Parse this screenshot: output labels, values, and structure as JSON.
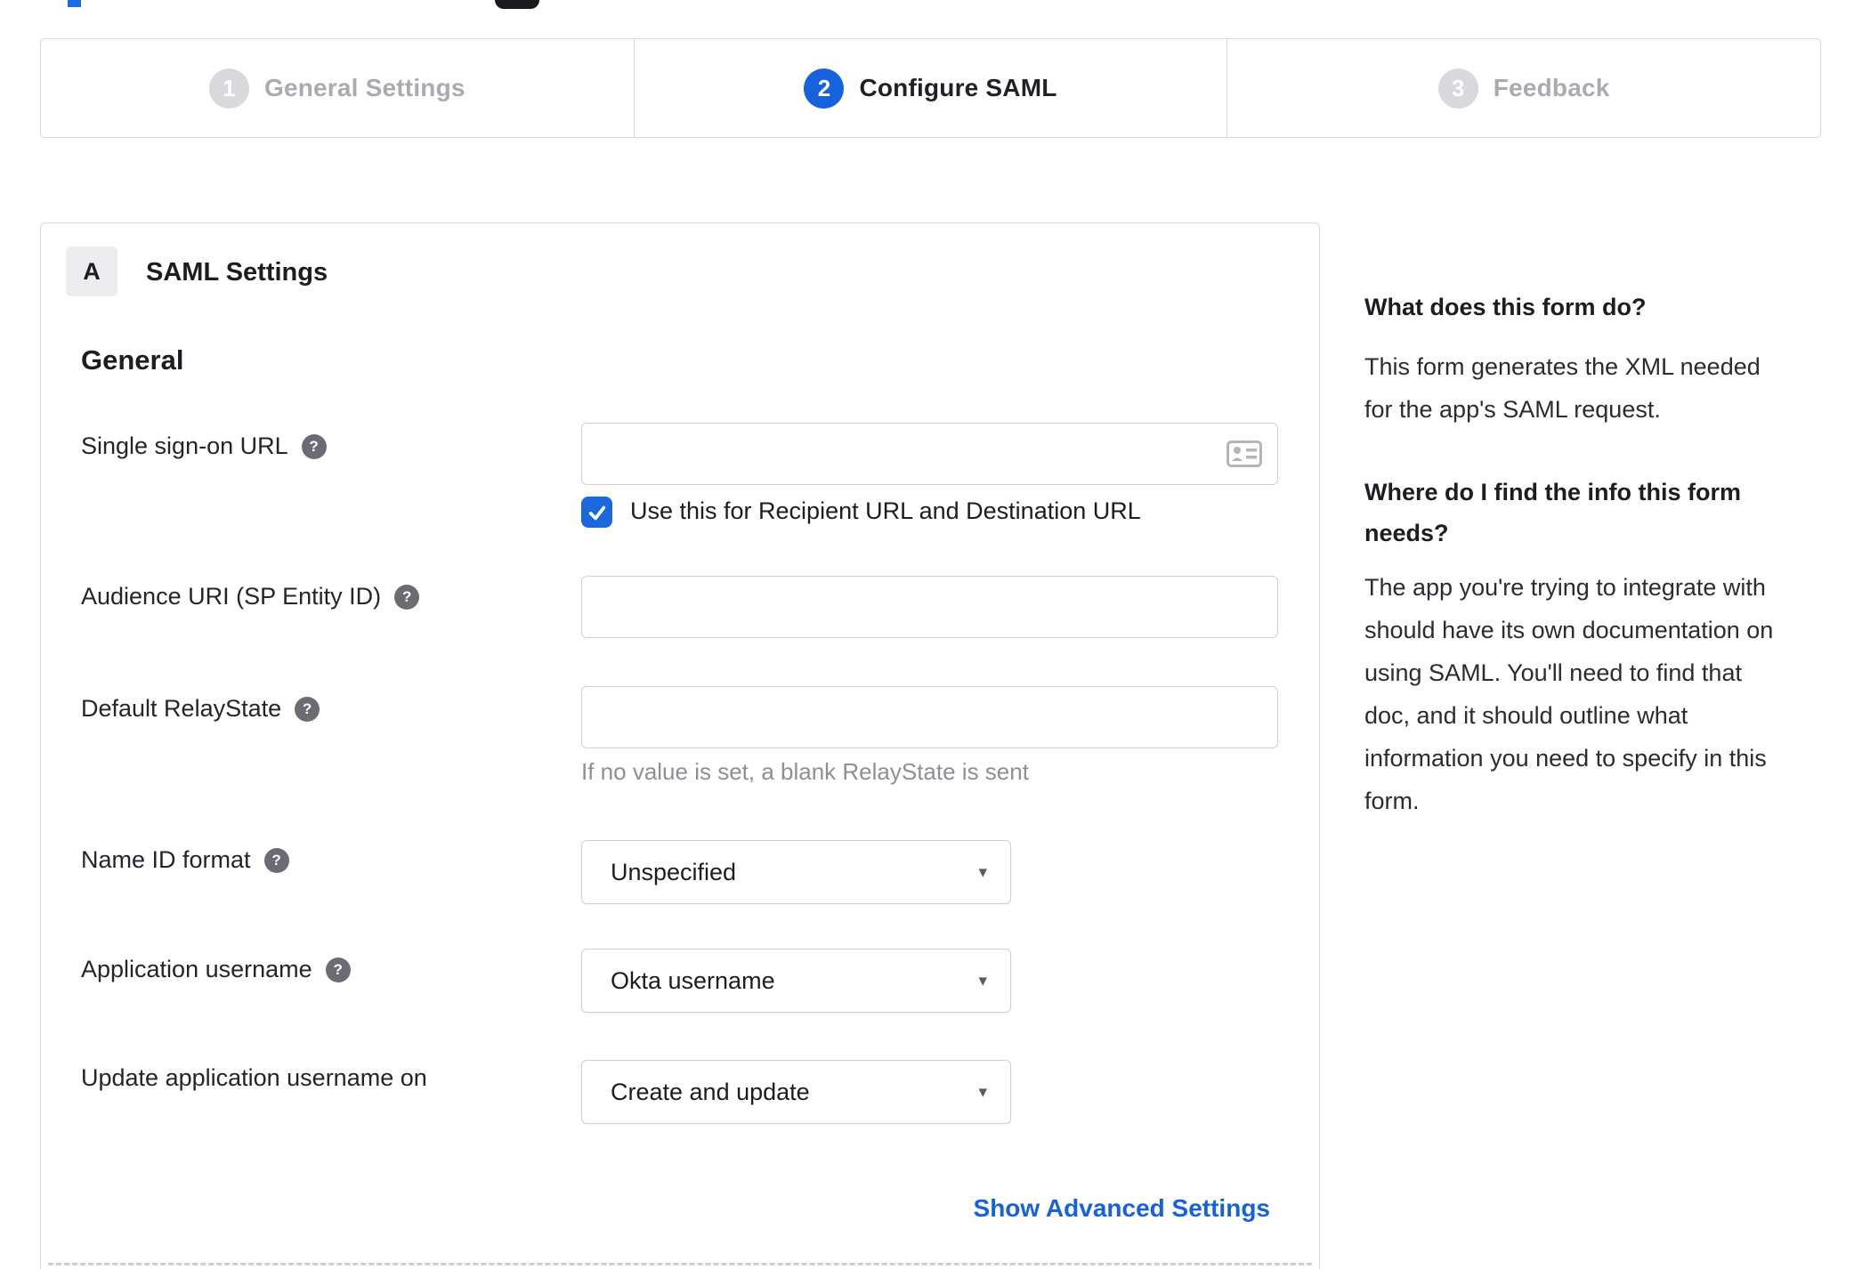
{
  "accent_color": "#1662dd",
  "stepper": {
    "steps": [
      {
        "number": "1",
        "label": "General Settings",
        "state": "inactive"
      },
      {
        "number": "2",
        "label": "Configure SAML",
        "state": "active"
      },
      {
        "number": "3",
        "label": "Feedback",
        "state": "inactive"
      }
    ]
  },
  "panel": {
    "section_badge": "A",
    "section_title": "SAML Settings",
    "group_heading": "General",
    "fields": [
      {
        "label": "Single sign-on URL",
        "type": "text",
        "value": "",
        "icon": "address-card"
      },
      {
        "label": "Audience URI (SP Entity ID)",
        "type": "text",
        "value": ""
      },
      {
        "label": "Default RelayState",
        "type": "text",
        "value": "",
        "hint": "If no value is set, a blank RelayState is sent"
      },
      {
        "label": "Name ID format",
        "type": "select",
        "value": "Unspecified"
      },
      {
        "label": "Application username",
        "type": "select",
        "value": "Okta username"
      },
      {
        "label": "Update application username on",
        "type": "select",
        "value": "Create and update"
      }
    ],
    "checkbox": {
      "label": "Use this for Recipient URL and Destination URL",
      "checked": true
    },
    "advanced_link": "Show Advanced Settings"
  },
  "sidebar": {
    "heading1": "What does this form do?",
    "body1": "This form generates the XML needed\nfor the app's SAML request.",
    "heading2": "Where do I find the info this form\nneeds?",
    "body2": "The app you're trying to integrate with\nshould have its own documentation on\nusing SAML. You'll need to find that\ndoc, and it should outline what\ninformation you need to specify in this\nform."
  },
  "icons": {
    "help": "?",
    "caret": "▾"
  }
}
